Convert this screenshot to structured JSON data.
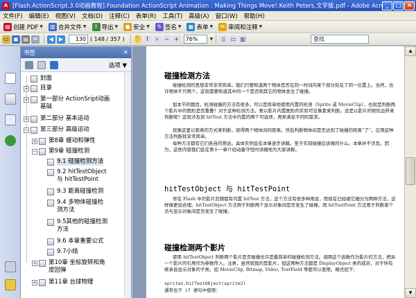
{
  "window": {
    "title": "[Flash.ActionScript.3.0动画教程].Foundation ActionScript Animation : Making Things Move!.Keith Peters.文字版.pdf - Adobe Acrobat Professional",
    "app_icon_letter": "A"
  },
  "menu": [
    "文件(F)",
    "编辑(E)",
    "视图(V)",
    "文档(D)",
    "注释(C)",
    "表单(R)",
    "工具(T)",
    "高级(A)",
    "窗口(W)",
    "帮助(H)"
  ],
  "toolbar1": {
    "create_pdf": "创建 PDF",
    "combine_files": "合并文件",
    "export": "导出",
    "secure": "安全",
    "sign": "签名",
    "forms": "表单",
    "review_comment": "审阅和注释"
  },
  "toolbar2": {
    "page_current": "130",
    "page_count": "( 148 / 357 )",
    "zoom": "76%",
    "search_placeholder": "查找"
  },
  "bookmarks_panel": {
    "title": "书签",
    "options_label": "选项",
    "items": {
      "i0": "封面",
      "i1": "目录",
      "i2a": "第一部分 ActionSript动画",
      "i2b": "基础",
      "i3": "第二部分 基本运动",
      "i4": "第三部分 高级运动",
      "i5": "第8章 缓动和弹性",
      "i6": "第9章 碰撞检测",
      "i7": "9.1 碰撞检测方法",
      "i8a": "9.2 hitTestObject",
      "i8b": "与 hitTestPoint",
      "i9": "9.3 距离碰撞检测",
      "i10a": "9.4 多物体碰撞检",
      "i10b": "测方法",
      "i11a": "9.5其他的碰撞检测",
      "i11b": "方法",
      "i12": "9.6 本章重要公式",
      "i13": "9.7小结",
      "i14a": "第10章 坐标旋转和角",
      "i14b": "度回弹",
      "i15": "第11章 台球物理"
    }
  },
  "document": {
    "h1": "碰撞检测方法",
    "p1": "碰撞检测的思想非常非常简单。我们只要知道两个物体是否在同一时间内某个部分处在了同一位置上。当然，也许物体不只两个，这就需要知道其中的一个是否和其它的物体发生了碰撞。",
    "p2": "如本节的题目，检测碰撞的方法有很多。可以是简单地使用内置的检测（Sprite 或 MovieClip），也就是判断两个影片中的图形是否重叠？对于这种检测方法，要以影片内置图形的实际可见像素来判断。还是以影片的矩形边界来判断呢？这就涉及到 hitTest 方法中内置的两个可选项，用来满足不同的需求。",
    "p3": "就像这里以距离的方式来判断，获得两个物体间的距离。然后判断物体间是否达到了碰撞的距离”了”，应用这种方法判断就非常简单。",
    "p4": "每种方法都有它们各自的用途。具体实例会在本章逐步讲解。至于实现碰撞后该做的什么。本章并不涉及。因为，这些内容我们会在第十一章介绍动量守恒时详细地为大家讲解。",
    "h2": "hitTestObject 与 hitTestPoint",
    "p5": "早在 Flash 中的影片剪辑都有内置 hitTest 方法，这个方法有很多种用途，而现在已经被它细分为两种方法，这样做更加合理。hitTestObject 方法用于判断两个显示对象间是否发生了碰撞，而 hitTestPoint 方法用于判断某个点与显示对象间是否发生了碰撞。",
    "h3": "碰撞检测两个影片",
    "p6": "使用 hitTestObject 判断两个影片是否碰撞也许是最简单的碰撞检测方法。调用这个函数作为影片的方法，把另一个影片的引用作为参数传入。注意，虽然就我的是影片，但这两种方法都是 DisplayObject 类的成员，对于所有继承自显示对象的子类，如 MovieClip, Bitmap, Video, TextField 等都可以使用。格式如下：",
    "code1": "sprite1.hitTestObject(sprite2)",
    "code2": "通常也下 if 语句中使用："
  }
}
